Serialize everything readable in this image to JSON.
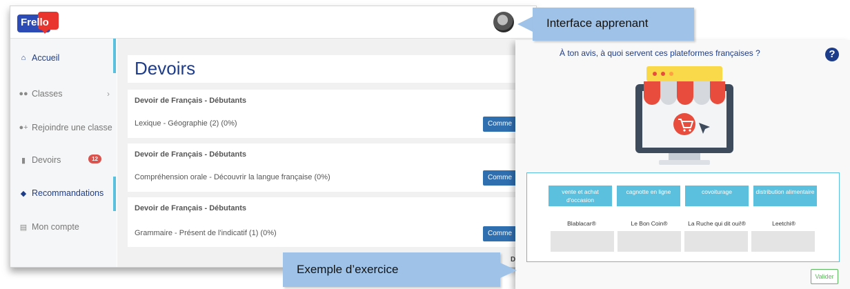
{
  "app": {
    "logo_text": "Frello"
  },
  "learner": {
    "sidebar": {
      "items": [
        {
          "label": "Accueil",
          "icon": "home-icon"
        },
        {
          "label": "Classes",
          "icon": "users-icon"
        },
        {
          "label": "Rejoindre une classe",
          "icon": "user-plus-icon"
        },
        {
          "label": "Devoirs",
          "icon": "clipboard-icon",
          "badge": "12"
        },
        {
          "label": "Recommandations",
          "icon": "compass-icon"
        },
        {
          "label": "Mon compte",
          "icon": "id-card-icon"
        }
      ]
    },
    "page_title": "Devoirs",
    "homeworks": [
      {
        "title": "Devoir de Français - Débutants",
        "subtitle": "Lexique - Géographie (2) (0%)",
        "button": "Comme"
      },
      {
        "title": "Devoir de Français - Débutants",
        "subtitle": "Compréhension orale - Découvrir la langue française (0%)",
        "button": "Comme"
      },
      {
        "title": "Devoir de Français - Débutants",
        "subtitle": "Grammaire - Présent de l'indicatif (1) (0%)",
        "button": "Comme"
      }
    ],
    "partial_text": "Devo"
  },
  "exercise": {
    "question": "À ton avis, à quoi servent ces plateformes françaises ?",
    "help_icon": "?",
    "choices": [
      "vente et achat d'occasion",
      "cagnotte en ligne",
      "covoiturage",
      "distribution alimentaire"
    ],
    "targets": [
      "Blablacar®",
      "Le Bon Coin®",
      "La Ruche qui dit oui!®",
      "Leetchi®"
    ],
    "submit_label": "Valider"
  },
  "callouts": {
    "top": "Interface apprenant",
    "bottom": "Exemple d’exercice"
  },
  "colors": {
    "brand_blue": "#1d3c8a",
    "accent_cyan": "#5bc0de",
    "button_blue": "#2f6fb0",
    "badge_red": "#d9534f",
    "callout_blue": "#9fc3e8",
    "valider_green": "#5cb85c"
  }
}
